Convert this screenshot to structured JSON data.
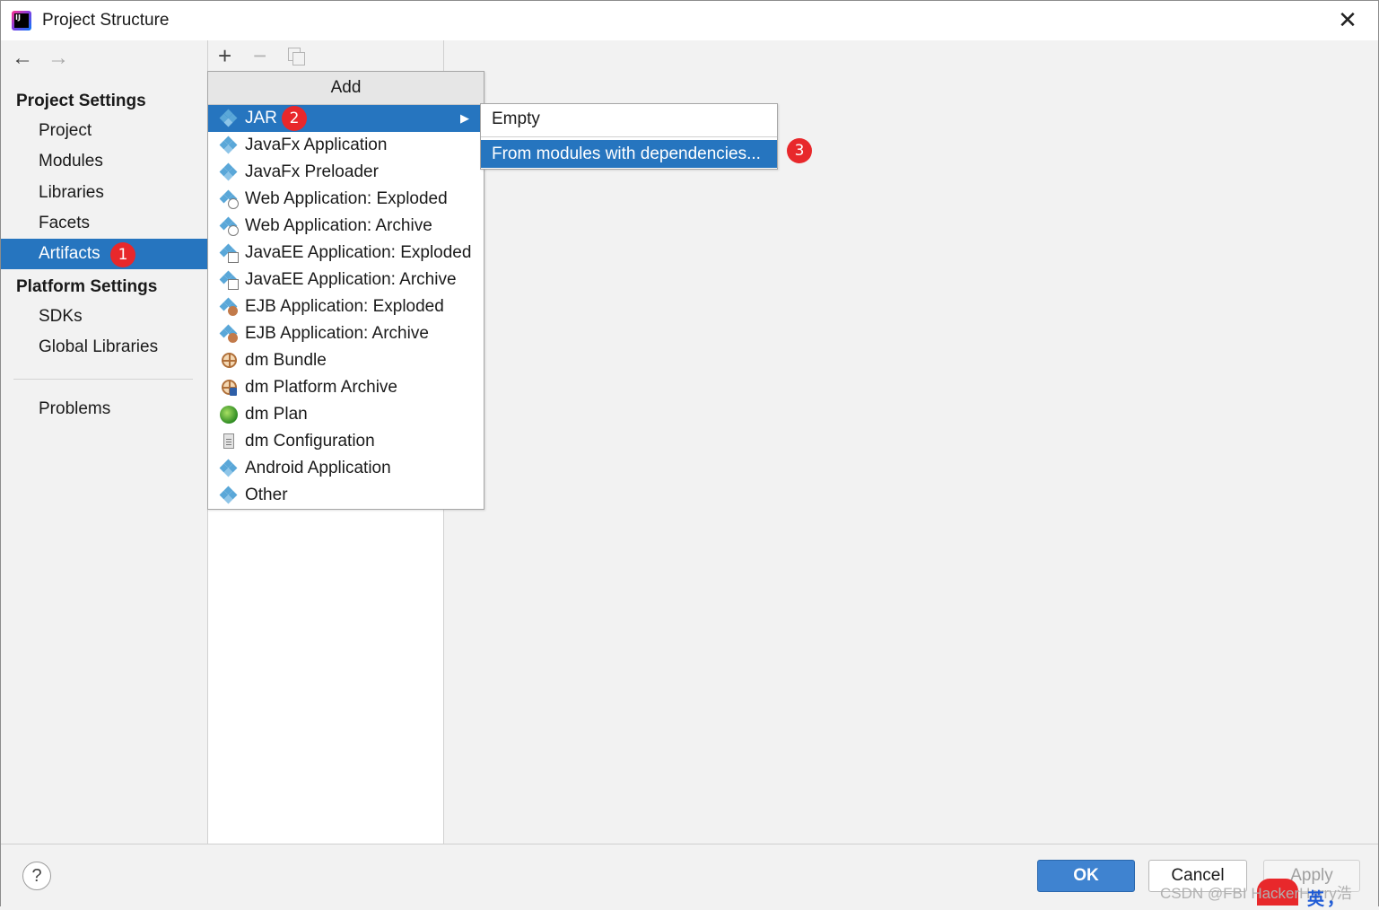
{
  "window": {
    "title": "Project Structure",
    "close_glyph": "✕"
  },
  "toolbar": {
    "back_glyph": "←",
    "forward_glyph": "→",
    "add_glyph": "+",
    "remove_glyph": "−"
  },
  "sidebar": {
    "project_settings_heading": "Project Settings",
    "items": [
      {
        "label": "Project"
      },
      {
        "label": "Modules"
      },
      {
        "label": "Libraries"
      },
      {
        "label": "Facets"
      },
      {
        "label": "Artifacts",
        "selected": true
      }
    ],
    "platform_settings_heading": "Platform Settings",
    "platform_items": [
      {
        "label": "SDKs"
      },
      {
        "label": "Global Libraries"
      }
    ],
    "problems_label": "Problems"
  },
  "badges": {
    "one": "1",
    "two": "2",
    "three": "3"
  },
  "add_menu": {
    "header": "Add",
    "items": [
      {
        "label": "JAR",
        "icon": "jar-icon",
        "selected": true,
        "submenu_arrow": "▶"
      },
      {
        "label": "JavaFx Application",
        "icon": "javafx-application-icon"
      },
      {
        "label": "JavaFx Preloader",
        "icon": "javafx-preloader-icon"
      },
      {
        "label": "Web Application: Exploded",
        "icon": "web-exploded-icon"
      },
      {
        "label": "Web Application: Archive",
        "icon": "web-archive-icon"
      },
      {
        "label": "JavaEE Application: Exploded",
        "icon": "javaee-exploded-icon"
      },
      {
        "label": "JavaEE Application: Archive",
        "icon": "javaee-archive-icon"
      },
      {
        "label": "EJB Application: Exploded",
        "icon": "ejb-exploded-icon"
      },
      {
        "label": "EJB Application: Archive",
        "icon": "ejb-archive-icon"
      },
      {
        "label": "dm Bundle",
        "icon": "dm-bundle-icon"
      },
      {
        "label": "dm Platform Archive",
        "icon": "dm-platform-archive-icon"
      },
      {
        "label": "dm Plan",
        "icon": "dm-plan-icon"
      },
      {
        "label": "dm Configuration",
        "icon": "dm-configuration-icon"
      },
      {
        "label": "Android Application",
        "icon": "android-application-icon"
      },
      {
        "label": "Other",
        "icon": "other-icon"
      }
    ]
  },
  "jar_submenu": {
    "items": [
      {
        "label": "Empty"
      },
      {
        "label": "From modules with dependencies...",
        "selected": true
      }
    ]
  },
  "footer": {
    "help_glyph": "?",
    "ok_label": "OK",
    "cancel_label": "Cancel",
    "apply_label": "Apply",
    "watermark": "CSDN @FBI HackerHarry浩",
    "ime_label": "英",
    "ime_punct": "，"
  },
  "colors": {
    "selection": "#2675bf",
    "badge": "#e8282b",
    "ok_button": "#3f83d0",
    "panel": "#f2f2f2"
  }
}
